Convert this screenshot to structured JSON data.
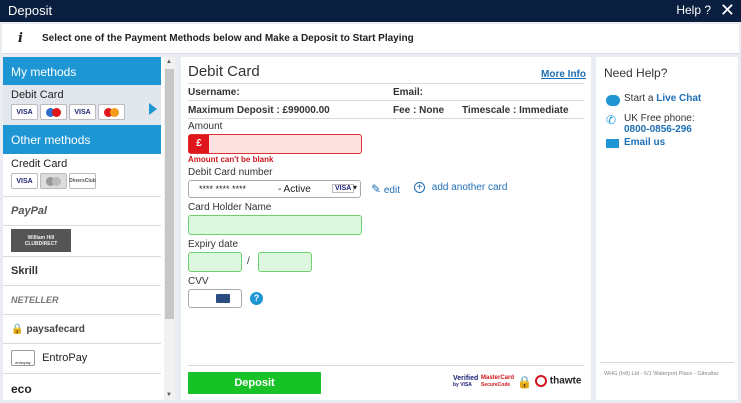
{
  "window": {
    "title": "Deposit",
    "help": "Help ?",
    "close": "✕"
  },
  "info": {
    "text": "Select one of the Payment Methods below and Make a Deposit to Start Playing"
  },
  "sidebar": {
    "my_methods": "My methods",
    "selected": {
      "label": "Debit Card",
      "cards": [
        "VISA",
        "Maestro",
        "VISA",
        "MasterCard"
      ]
    },
    "other_methods": "Other methods",
    "credit_card": {
      "label": "Credit Card",
      "cards": [
        "VISA",
        "MasterCard",
        "Diners Club"
      ]
    },
    "items": [
      "PayPal",
      "William Hill CLUBDIRECT",
      "Skrill",
      "NETELLER",
      "paysafecard",
      "EntroPay",
      "eco"
    ],
    "entropay_logo": "entropay"
  },
  "main": {
    "heading": "Debit Card",
    "more_info": "More Info",
    "username_label": "Username:",
    "email_label": "Email:",
    "max_deposit": "Maximum Deposit : £99000.00",
    "fee": "Fee : None",
    "timescale": "Timescale : Immediate",
    "amount_label": "Amount",
    "currency": "£",
    "amount_error": "Amount can't be blank",
    "card_number_label": "Debit Card number",
    "card_masked": "**** **** ****",
    "card_status": "- Active",
    "card_brand": "VISA",
    "edit": "edit",
    "add_card": "add another card",
    "holder_label": "Card Holder Name",
    "expiry_label": "Expiry date",
    "expiry_sep": "/",
    "cvv_label": "CVV",
    "cvv_help": "?",
    "deposit_button": "Deposit",
    "trust": {
      "vbv_top": "Verified",
      "vbv_bottom": "by VISA",
      "msc_top": "MasterCard",
      "msc_bottom": "SecureCode",
      "thawte": "thawte"
    }
  },
  "help": {
    "title": "Need Help?",
    "chat_prefix": "Start a",
    "chat_link": "Live Chat",
    "phone_label": "UK Free phone:",
    "phone": "0800-0856-296",
    "email": "Email us",
    "footer": "WHG (Intl) Ltd - 6/1 Waterport Place - Gibraltar"
  },
  "colors": {
    "header": "#0a1f3f",
    "accent": "#1e96d4",
    "deposit": "#17c226",
    "error": "#e0161d"
  }
}
